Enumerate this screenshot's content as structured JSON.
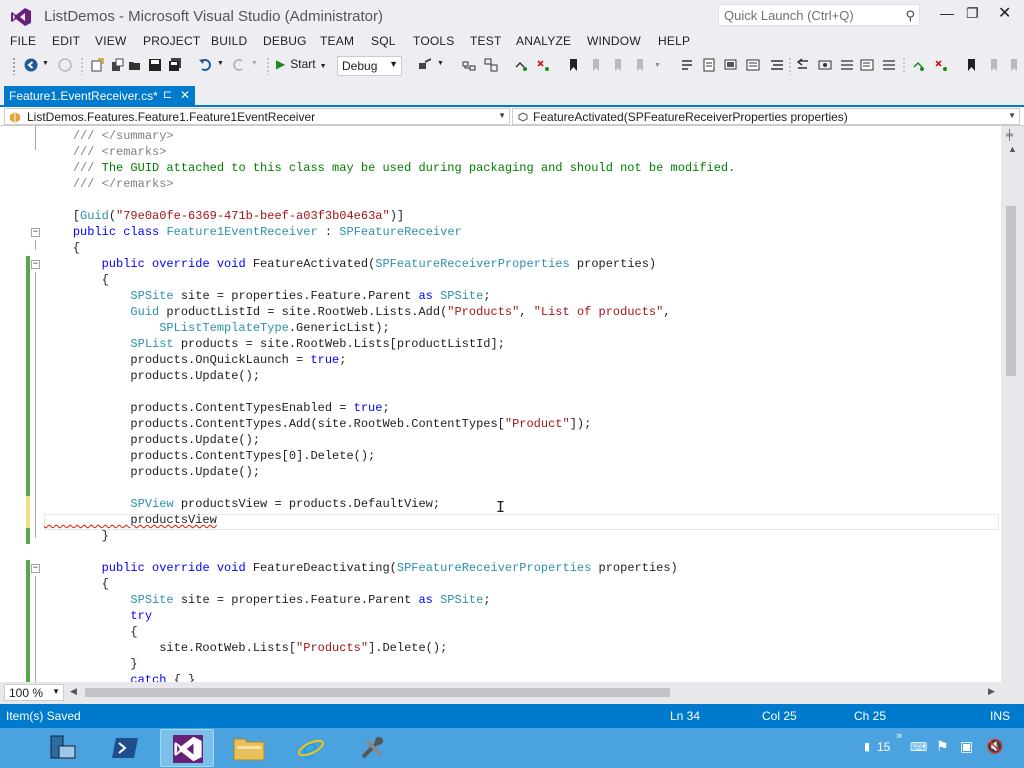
{
  "window": {
    "title": "ListDemos - Microsoft Visual Studio (Administrator)",
    "quick_launch_placeholder": "Quick Launch (Ctrl+Q)"
  },
  "menu": [
    "FILE",
    "EDIT",
    "VIEW",
    "PROJECT",
    "BUILD",
    "DEBUG",
    "TEAM",
    "SQL",
    "TOOLS",
    "TEST",
    "ANALYZE",
    "WINDOW",
    "HELP"
  ],
  "toolbar": {
    "start_label": "Start",
    "configuration": "Debug"
  },
  "tab": {
    "label": "Feature1.EventReceiver.cs*"
  },
  "navbar": {
    "type_path": "ListDemos.Features.Feature1.Feature1EventReceiver",
    "member": "FeatureActivated(SPFeatureReceiverProperties properties)"
  },
  "editor": {
    "lines": [
      "    /// </summary>",
      "    /// <remarks>",
      "    /// The GUID attached to this class may be used during packaging and should not be modified.",
      "    /// </remarks>",
      "",
      "    [Guid(\"79e0a0fe-6369-471b-beef-a03f3b04e63a\")]",
      "    public class Feature1EventReceiver : SPFeatureReceiver",
      "    {",
      "        public override void FeatureActivated(SPFeatureReceiverProperties properties)",
      "        {",
      "            SPSite site = properties.Feature.Parent as SPSite;",
      "            Guid productListId = site.RootWeb.Lists.Add(\"Products\", \"List of products\",",
      "                SPListTemplateType.GenericList);",
      "            SPList products = site.RootWeb.Lists[productListId];",
      "            products.OnQuickLaunch = true;",
      "            products.Update();",
      "",
      "            products.ContentTypesEnabled = true;",
      "            products.ContentTypes.Add(site.RootWeb.ContentTypes[\"Product\"]);",
      "            products.Update();",
      "            products.ContentTypes[0].Delete();",
      "            products.Update();",
      "",
      "            SPView productsView = products.DefaultView;",
      "            productsView",
      "        }",
      "",
      "        public override void FeatureDeactivating(SPFeatureReceiverProperties properties)",
      "        {",
      "            SPSite site = properties.Feature.Parent as SPSite;",
      "            try",
      "            {",
      "                site.RootWeb.Lists[\"Products\"].Delete();",
      "            }",
      "            catch { }"
    ]
  },
  "zoom": "100 %",
  "status": {
    "message": "Item(s) Saved",
    "line": "Ln 34",
    "column": "Col 25",
    "char": "Ch 25",
    "mode": "INS"
  },
  "taskbar": {
    "tray_number": "15"
  },
  "colors": {
    "accent": "#007acc",
    "chrome": "#eeeef2",
    "keyword": "#0000ff",
    "type": "#2b91af",
    "string": "#a31515",
    "comment": "#008000",
    "taskbar": "#4aa3df",
    "vs_purple": "#68217a"
  }
}
